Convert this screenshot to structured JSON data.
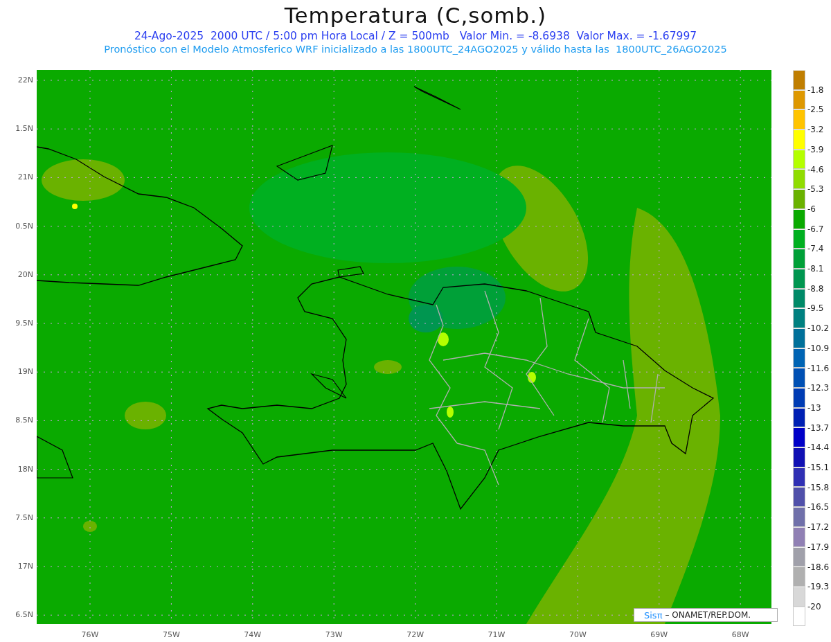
{
  "title": "Temperatura (C,somb.)",
  "subtitle": "24-Ago-2025  2000 UTC / 5:00 pm Hora Local / Z = 500mb   Valor Min. = -8.6938  Valor Max. = -1.67997",
  "description": "Pronóstico con el Modelo Atmosferico WRF inicializado a las 1800UTC_24AGO2025 y válido hasta las  1800UTC_26AGO2025",
  "y_axis": [
    "22N",
    "1.5N",
    "21N",
    "0.5N",
    "20N",
    "9.5N",
    "19N",
    "8.5N",
    "18N",
    "7.5N",
    "17N",
    "6.5N"
  ],
  "x_axis": [
    "76W",
    "75W",
    "74W",
    "73W",
    "72W",
    "71W",
    "70W",
    "69W",
    "68W"
  ],
  "colorbar": [
    {
      "color": "#c07e00",
      "label": "-1.8"
    },
    {
      "color": "#de9800",
      "label": "-2.5"
    },
    {
      "color": "#ffc400",
      "label": "-3.2"
    },
    {
      "color": "#ffff00",
      "label": "-3.9"
    },
    {
      "color": "#b4ff00",
      "label": "-4.6"
    },
    {
      "color": "#90dc00",
      "label": "-5.3"
    },
    {
      "color": "#6ab200",
      "label": "-6"
    },
    {
      "color": "#0aaa00",
      "label": "-6.7"
    },
    {
      "color": "#00b020",
      "label": "-7.4"
    },
    {
      "color": "#00a038",
      "label": "-8.1"
    },
    {
      "color": "#009650",
      "label": "-8.8"
    },
    {
      "color": "#008a68",
      "label": "-9.5"
    },
    {
      "color": "#008080",
      "label": "-10.2"
    },
    {
      "color": "#00709a",
      "label": "-10.9"
    },
    {
      "color": "#0064b4",
      "label": "-11.6"
    },
    {
      "color": "#0050b4",
      "label": "-12.3"
    },
    {
      "color": "#003cb4",
      "label": "-13"
    },
    {
      "color": "#0020b4",
      "label": "-13.7"
    },
    {
      "color": "#0000c8",
      "label": "-14.4"
    },
    {
      "color": "#1010b4",
      "label": "-15.1"
    },
    {
      "color": "#3030b4",
      "label": "-15.8"
    },
    {
      "color": "#5050aa",
      "label": "-16.5"
    },
    {
      "color": "#7070aa",
      "label": "-17.2"
    },
    {
      "color": "#9080b4",
      "label": "-17.9"
    },
    {
      "color": "#a0a0aa",
      "label": "-18.6"
    },
    {
      "color": "#b0b0b0",
      "label": "-19.3"
    },
    {
      "color": "#d8d8d8",
      "label": "-20"
    },
    {
      "color": "#ffffff"
    }
  ],
  "credit": {
    "brand": "Sisπ",
    "text": "– ONAMET/REP.DOM."
  }
}
